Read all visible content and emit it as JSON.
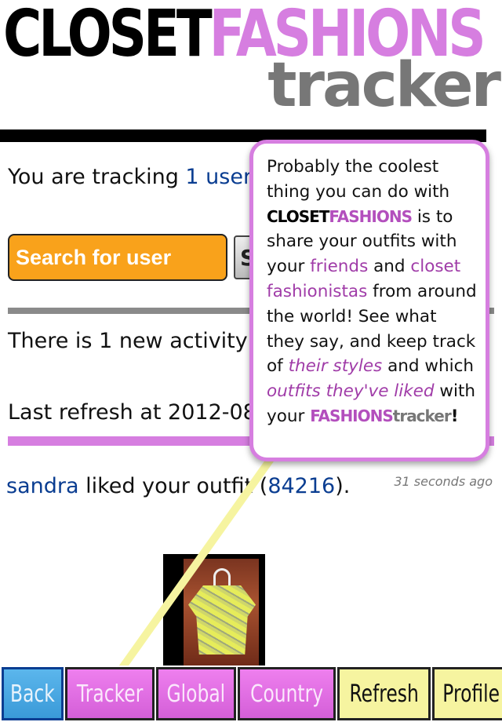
{
  "logo": {
    "word1": "CLOSET",
    "word2": "FASHIONS",
    "sub": "tracker"
  },
  "tracking": {
    "prefix": "You are tracking ",
    "link": "1 user"
  },
  "search": {
    "placeholder": "Search for user",
    "button_label": "S"
  },
  "activity_text": "There is 1 new activity o",
  "refresh_text": "Last refresh at 2012-08-2",
  "feed": {
    "user": "sandra",
    "action": " liked your outfit (",
    "outfit_id": "84216",
    "suffix": ").",
    "time": "31 seconds ago"
  },
  "tooltip": {
    "t1": "Probably the coolest thing you can do with ",
    "brand_a": "CLOSET",
    "brand_b": "FASHIONS",
    "t2": " is to share your outfits with your ",
    "friends": "friends",
    "t3": " and ",
    "fashionistas": "closet fashionistas",
    "t4": " from around the world! See what they say, and keep track of ",
    "their_styles": "their styles",
    "t5": " and which ",
    "outfits_liked": "outfits they've liked",
    "t6": " with your ",
    "brand_c": "FASHIONS",
    "brand_d": "tracker",
    "t7": "!"
  },
  "tabs": {
    "back": "Back",
    "tracker": "Tracker",
    "global": "Global",
    "country": "Country",
    "refresh": "Refresh",
    "profile": "Profile"
  },
  "colors": {
    "pink": "#d67ee0",
    "orange": "#f9a21b",
    "link_blue": "#0a3d91",
    "tab_yellow": "#f6f4a0"
  }
}
